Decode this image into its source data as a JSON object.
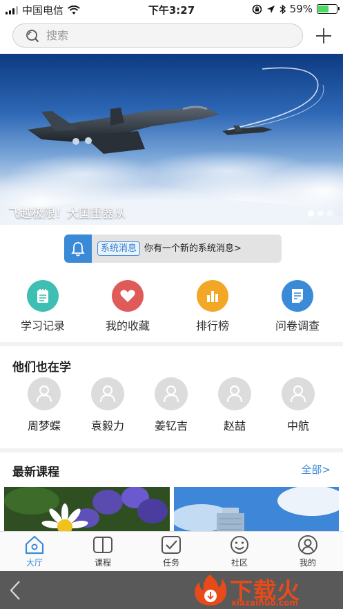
{
  "status_bar": {
    "carrier": "中国电信",
    "time": "下午3:27",
    "battery": "59%",
    "battery_level": 0.59
  },
  "header": {
    "search_placeholder": "搜索",
    "add_icon": "plus-icon"
  },
  "banner": {
    "caption": "飞越极限！大国重器从",
    "slide_count": 3,
    "active_slide": 1
  },
  "notice": {
    "tag": "系统消息",
    "message": "你有一个新的系统消息>"
  },
  "quick_entries": [
    {
      "label": "学习记录",
      "icon": "notepad-icon",
      "color": "#3fbfb3"
    },
    {
      "label": "我的收藏",
      "icon": "heart-icon",
      "color": "#e05a5a"
    },
    {
      "label": "排行榜",
      "icon": "bar-chart-icon",
      "color": "#f3a825"
    },
    {
      "label": "问卷调查",
      "icon": "document-icon",
      "color": "#3b8ad8"
    }
  ],
  "learners": {
    "title": "他们也在学",
    "people": [
      "周梦蝶",
      "袁毅力",
      "姜钇吉",
      "赵喆",
      "中航"
    ]
  },
  "courses": {
    "title": "最新课程",
    "all_link": "全部>"
  },
  "tabbar": {
    "tabs": [
      {
        "label": "大厅",
        "icon": "home-icon",
        "active": true
      },
      {
        "label": "课程",
        "icon": "book-icon",
        "active": false
      },
      {
        "label": "任务",
        "icon": "checkmark-icon",
        "active": false
      },
      {
        "label": "社区",
        "icon": "smiley-icon",
        "active": false
      },
      {
        "label": "我的",
        "icon": "user-icon",
        "active": false
      }
    ]
  },
  "watermark": {
    "title": "下载火",
    "url": "xiazaihuo.com"
  },
  "colors": {
    "accent": "#3b8ad8",
    "watermark": "#e84a1a"
  }
}
